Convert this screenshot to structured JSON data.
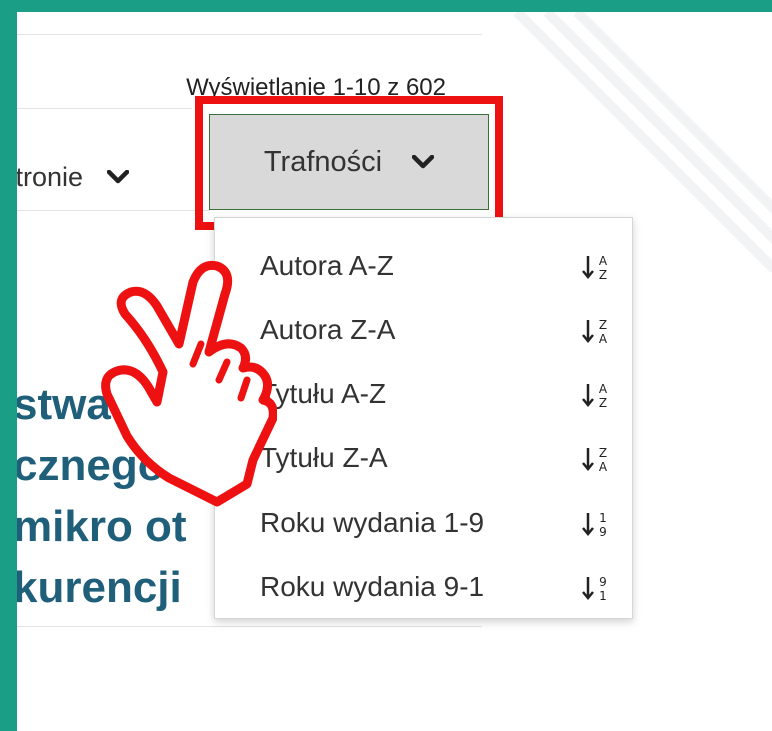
{
  "results": {
    "count_text": "Wyświetlanie 1-10 z 602"
  },
  "per_page": {
    "label": "stronie",
    "chevron_icon": "chevron-down-icon"
  },
  "sort": {
    "selected": "Trafności",
    "chevron_icon": "chevron-down-icon",
    "options": [
      {
        "label": "Autora A-Z",
        "icon": "sort-alpha-asc-icon",
        "top": "A",
        "bottom": "Z"
      },
      {
        "label": "Autora Z-A",
        "icon": "sort-alpha-desc-icon",
        "top": "Z",
        "bottom": "A"
      },
      {
        "label": "Tytułu A-Z",
        "icon": "sort-alpha-asc-icon",
        "top": "A",
        "bottom": "Z"
      },
      {
        "label": "Tytułu Z-A",
        "icon": "sort-alpha-desc-icon",
        "top": "Z",
        "bottom": "A"
      },
      {
        "label": "Roku wydania 1-9",
        "icon": "sort-numeric-asc-icon",
        "top": "1",
        "bottom": "9"
      },
      {
        "label": "Roku wydania 9-1",
        "icon": "sort-numeric-desc-icon",
        "top": "9",
        "bottom": "1"
      }
    ]
  },
  "result_title": {
    "lines": [
      "stwa",
      "cznego s",
      "mikro ot",
      "kurencji"
    ]
  },
  "colors": {
    "frame": "#1a9e86",
    "highlight": "#ee1111",
    "title": "#1f5f7a"
  }
}
